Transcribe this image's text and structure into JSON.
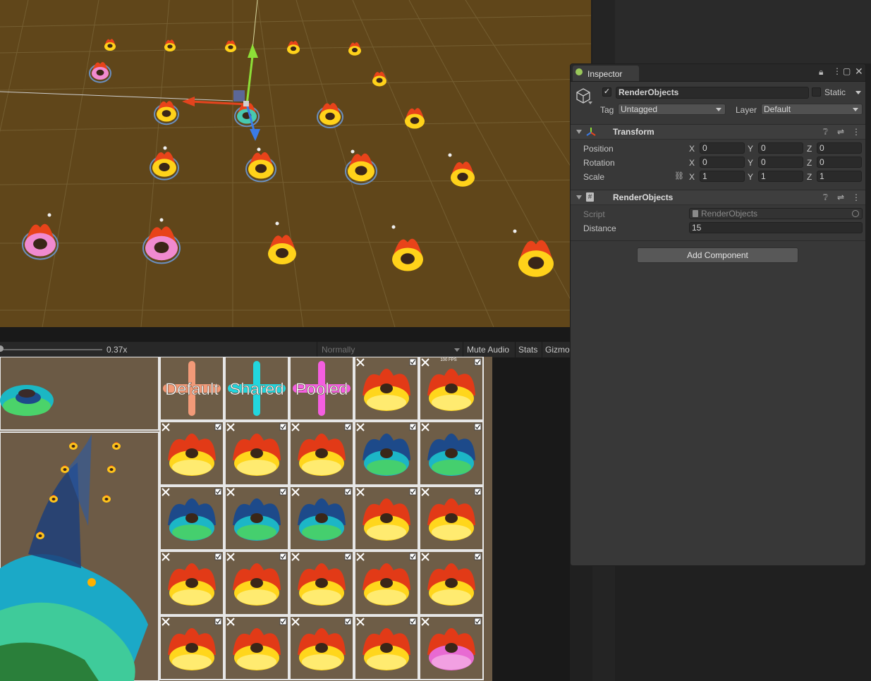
{
  "toolbar": {
    "scale_value": "0.37x",
    "vsync_dropdown": "Normally",
    "mute_audio": "Mute Audio",
    "stats": "Stats",
    "gizmos": "Gizmo"
  },
  "game_view": {
    "labels": [
      "Default",
      "Shared",
      "Pooled"
    ],
    "label_colors": [
      "#f39a78",
      "#22d6de",
      "#f45ee0"
    ],
    "fps_text": "100 FPS"
  },
  "inspector": {
    "tab_label": "Inspector",
    "object_name": "RenderObjects",
    "active_check": "✓",
    "static_label": "Static",
    "tag_label": "Tag",
    "tag_value": "Untagged",
    "layer_label": "Layer",
    "layer_value": "Default",
    "transform": {
      "title": "Transform",
      "position_label": "Position",
      "rotation_label": "Rotation",
      "scale_label": "Scale",
      "position": {
        "x": "0",
        "y": "0",
        "z": "0"
      },
      "rotation": {
        "x": "0",
        "y": "0",
        "z": "0"
      },
      "scale": {
        "x": "1",
        "y": "1",
        "z": "1"
      }
    },
    "script_component": {
      "title": "RenderObjects",
      "script_label": "Script",
      "script_value": "RenderObjects",
      "distance_label": "Distance",
      "distance_value": "15"
    },
    "add_component": "Add Component"
  },
  "axis_letters": {
    "x": "X",
    "y": "Y",
    "z": "Z"
  },
  "colors": {
    "scene_ground": "#60461a",
    "inspector_bg": "#383838",
    "toolbar_bg": "#282828"
  }
}
